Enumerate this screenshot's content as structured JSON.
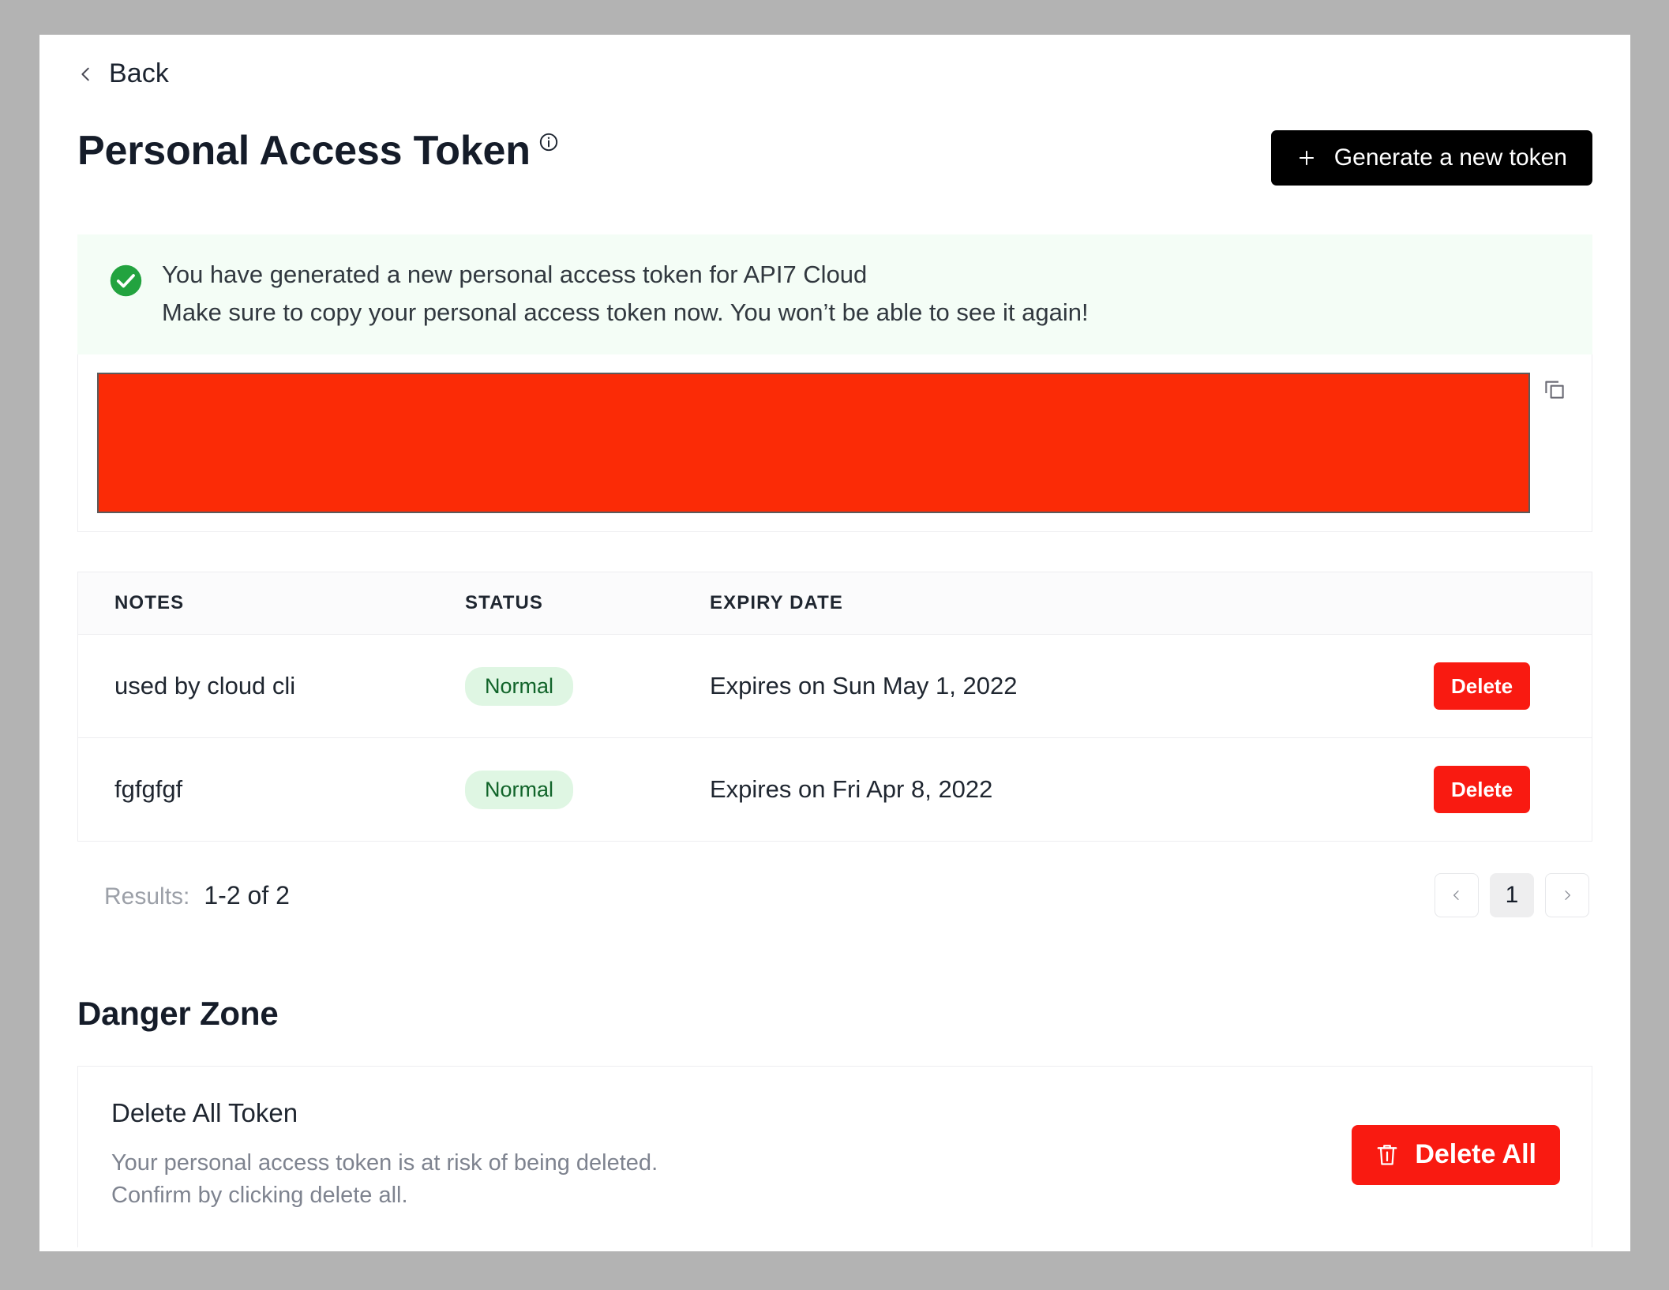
{
  "backlink": {
    "label": "Back",
    "icon": "chevron-left-icon"
  },
  "header": {
    "title": "Personal Access Token",
    "info_icon": "info-icon",
    "generate_button": {
      "label": "Generate a new token",
      "icon": "plus-icon"
    }
  },
  "alert": {
    "icon": "check-circle-icon",
    "line1": "You have generated a new personal access token for API7 Cloud",
    "line2": "Make sure to copy your personal access token now. You won’t be able to see it again!",
    "background": "#f4fdf6",
    "icon_color": "#22a33f"
  },
  "token_field": {
    "value": "",
    "redacted": true,
    "redaction_color": "#fb2b06",
    "copy_icon": "copy-icon"
  },
  "table": {
    "columns": [
      "NOTES",
      "STATUS",
      "EXPIRY DATE"
    ],
    "rows": [
      {
        "notes": "used by cloud cli",
        "status": "Normal",
        "expiry": "Expires on Sun May 1, 2022",
        "action": "Delete"
      },
      {
        "notes": "fgfgfgf",
        "status": "Normal",
        "expiry": "Expires on Fri Apr 8, 2022",
        "action": "Delete"
      }
    ],
    "status_badge_bg": "#dff6e3",
    "status_badge_color": "#11642a",
    "delete_button_color": "#f91a11"
  },
  "footer": {
    "results_label": "Results:",
    "results_value": "1-2 of 2",
    "pagination": {
      "prev_icon": "chevron-left-icon",
      "current_page": "1",
      "next_icon": "chevron-right-icon"
    }
  },
  "danger_zone": {
    "title": "Danger Zone",
    "card_heading": "Delete All Token",
    "desc_line1": "Your personal access token is at risk of being deleted.",
    "desc_line2": "Confirm by clicking delete all.",
    "button": {
      "label": "Delete All",
      "icon": "trash-icon",
      "color": "#f91a11"
    }
  }
}
